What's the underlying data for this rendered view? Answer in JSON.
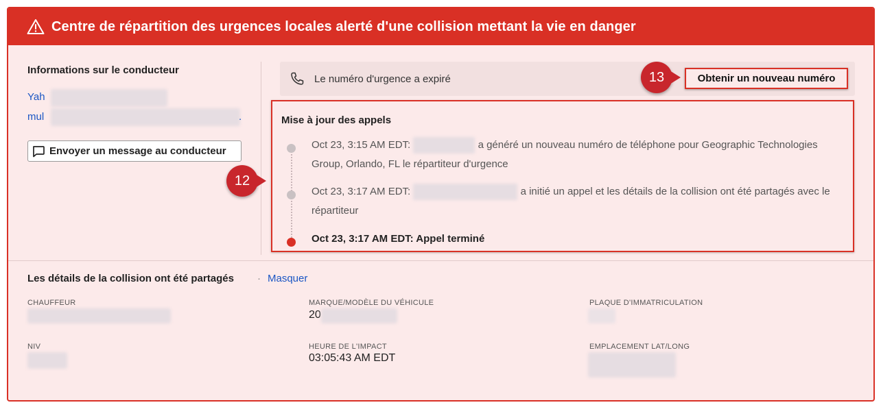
{
  "banner": {
    "title": "Centre de répartition des urgences locales alerté d'une collision mettant la vie en danger",
    "icon": "warning-triangle-icon",
    "color": "#d93025"
  },
  "driver": {
    "section_title": "Informations sur le conducteur",
    "name_prefix": "Yah",
    "email_prefix": "mul",
    "email_suffix": ".",
    "message_button_label": "Envoyer un message au conducteur",
    "message_icon": "chat-bubble-icon"
  },
  "emergency_number": {
    "status_text": "Le numéro d'urgence a expiré",
    "icon": "phone-icon",
    "new_number_button_label": "Obtenir un nouveau numéro"
  },
  "callouts": {
    "update_marker": "12",
    "button_marker": "13"
  },
  "call_updates": {
    "title": "Mise à jour des appels",
    "events": [
      {
        "timestamp": "Oct 23, 3:15 AM EDT:",
        "text": "a généré un nouveau numéro de téléphone pour Geographic Technologies Group, Orlando, FL le répartiteur d'urgence"
      },
      {
        "timestamp": "Oct 23, 3:17 AM EDT:",
        "text": "a initié un appel et les détails de la collision ont été partagés avec le répartiteur"
      },
      {
        "timestamp": "Oct 23, 3:17 AM EDT:",
        "text": "Appel terminé"
      }
    ]
  },
  "collision_details": {
    "title": "Les détails de la collision ont été partagés",
    "separator": "·",
    "hide_link": "Masquer",
    "fields": {
      "driver_label": "CHAUFFEUR",
      "vehicle_label": "MARQUE/MODÈLE DU VÉHICULE",
      "vehicle_value_prefix": "20",
      "plate_label": "PLAQUE D'IMMATRICULATION",
      "vin_label": "NIV",
      "impact_time_label": "HEURE DE L'IMPACT",
      "impact_time_value": "03:05:43 AM EDT",
      "location_label": "EMPLACEMENT LAT/LONG"
    }
  }
}
